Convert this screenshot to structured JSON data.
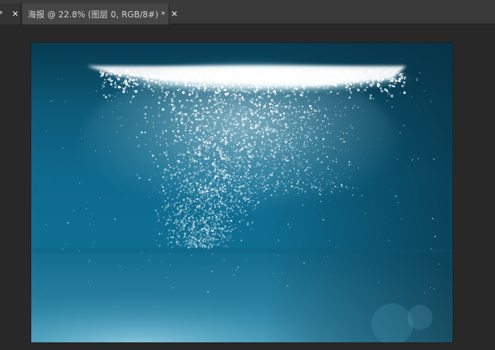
{
  "tabs": [
    {
      "modified_marker": "*",
      "close_glyph": "✕"
    },
    {
      "title": "海报 @ 22.8% (图层 0, RGB/8#) *",
      "close_glyph": "✕"
    }
  ],
  "colors": {
    "workspace_bg": "#282828",
    "tabbar_bg": "#3a3a3a",
    "active_tab_bg": "#464646",
    "tab_text": "#d6d6d6",
    "water_deep": "#083f55",
    "water_mid": "#0e6e93",
    "water_light": "#7fc8de",
    "foam": "#ffffff"
  },
  "icons": {
    "close": "close-icon"
  }
}
